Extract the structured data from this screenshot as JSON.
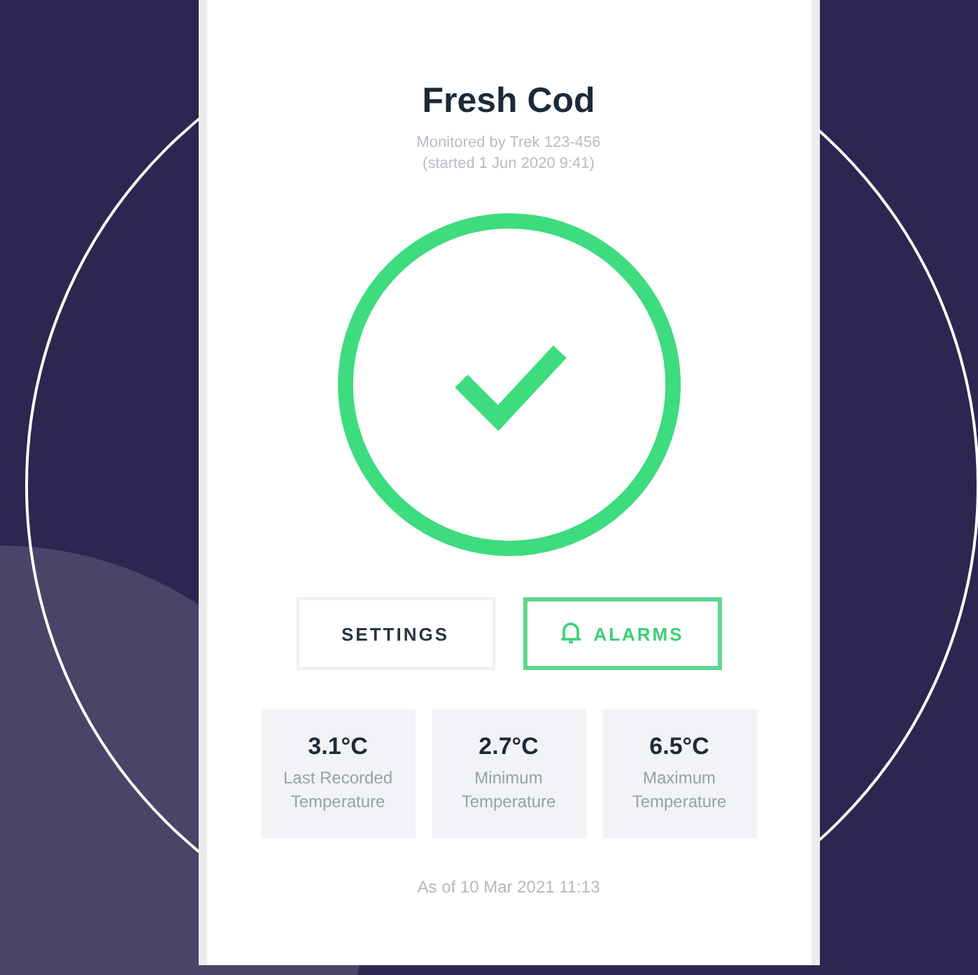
{
  "title": "Fresh Cod",
  "subtitle": [
    "Monitored by Trek 123-456",
    "(started 1 Jun 2020 9:41)"
  ],
  "status_ok": true,
  "buttons": [
    {
      "label": "SETTINGS",
      "kind": "plain"
    },
    {
      "label": "ALARMS",
      "kind": "alarm"
    }
  ],
  "stats": [
    {
      "value": "3.1°C",
      "label": "Last Recorded Temperature"
    },
    {
      "value": "2.7°C",
      "label": "Minimum Temperature"
    },
    {
      "value": "6.5°C",
      "label": "Maximum Temperature"
    }
  ],
  "footer": "As of 10 Mar 2021 11:13"
}
